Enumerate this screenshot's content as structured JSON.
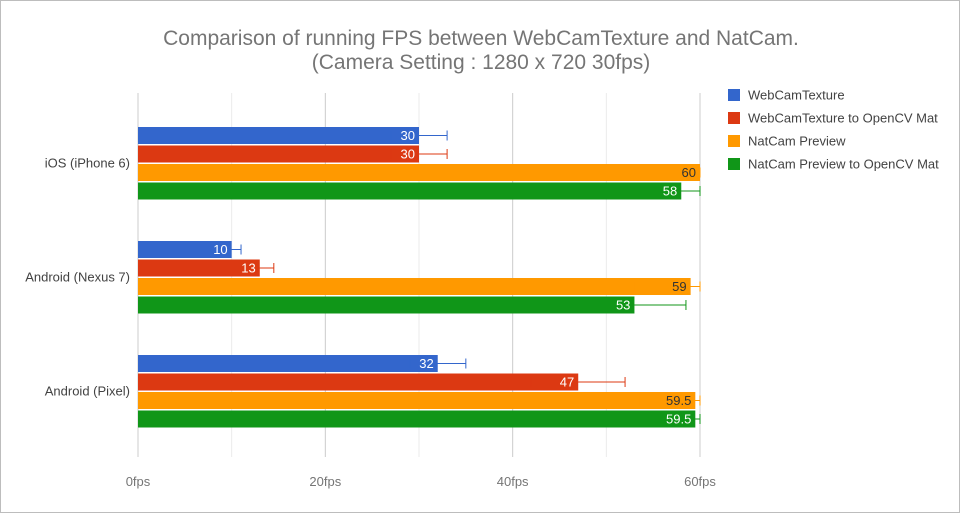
{
  "chart_data": {
    "type": "bar",
    "orientation": "horizontal",
    "title": "Comparison of running FPS between WebCamTexture and NatCam.",
    "subtitle": "(Camera Setting : 1280 x 720 30fps)",
    "categories": [
      "iOS (iPhone 6)",
      "Android (Nexus 7)",
      "Android (Pixel)"
    ],
    "xlim": [
      0,
      60
    ],
    "xticks": [
      {
        "value": 0,
        "label": "0fps"
      },
      {
        "value": 20,
        "label": "20fps"
      },
      {
        "value": 40,
        "label": "40fps"
      },
      {
        "value": 60,
        "label": "60fps"
      }
    ],
    "grid": true,
    "legend_position": "right",
    "series": [
      {
        "name": "WebCamTexture",
        "color": "#3366cc",
        "label_color": "#ffffff",
        "values": [
          30,
          10,
          32
        ],
        "labels": [
          "30",
          "10",
          "32"
        ],
        "errors": [
          [
            27,
            33
          ],
          [
            9,
            11
          ],
          [
            29,
            35
          ]
        ]
      },
      {
        "name": "WebCamTexture to OpenCV Mat",
        "color": "#dc3912",
        "label_color": "#ffffff",
        "values": [
          30,
          13,
          47
        ],
        "labels": [
          "30",
          "13",
          "47"
        ],
        "errors": [
          [
            27,
            33
          ],
          [
            12,
            14.5
          ],
          [
            42,
            52
          ]
        ]
      },
      {
        "name": "NatCam Preview",
        "color": "#ff9900",
        "label_color": "#333333",
        "values": [
          60,
          59,
          59.5
        ],
        "labels": [
          "60",
          "59",
          "59.5"
        ],
        "errors": [
          [
            54,
            60
          ],
          [
            53,
            60
          ],
          [
            53.5,
            60
          ]
        ]
      },
      {
        "name": "NatCam Preview to OpenCV Mat",
        "color": "#109618",
        "label_color": "#ffffff",
        "values": [
          58,
          53,
          59.5
        ],
        "labels": [
          "58",
          "53",
          "59.5"
        ],
        "errors": [
          [
            52,
            60
          ],
          [
            48,
            58.5
          ],
          [
            53.5,
            60
          ]
        ]
      }
    ]
  }
}
